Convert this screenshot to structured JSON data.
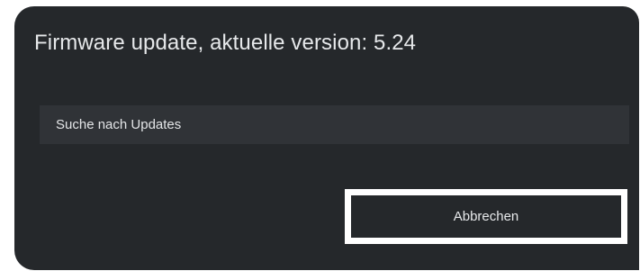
{
  "dialog": {
    "title": "Firmware update, aktuelle version: 5.24",
    "status_text": "Suche nach Updates",
    "cancel_label": "Abbrechen"
  },
  "colors": {
    "dialog_background": "#25282b",
    "status_row_background": "#303337",
    "focus_border": "#ffffff",
    "text": "#e6e8ea"
  }
}
